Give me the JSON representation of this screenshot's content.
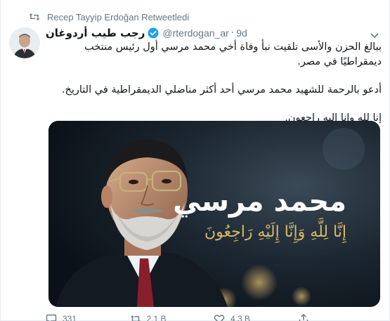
{
  "retweet": {
    "label": "Recep Tayyip Erdoğan Retweetledi",
    "icon": "retweet-icon"
  },
  "author": {
    "name": "رجب طيب أردوغان",
    "handle": "@rterdogan_ar",
    "separator": "·",
    "time": "9d",
    "verified_icon": "verified-badge-icon"
  },
  "tweet": {
    "paragraphs": [
      "ببالغ الحزن والأسى تلقيت نبأ وفاة أخي محمد مرسي أول رئيس منتخب ديمقراطيًا في مصر.",
      "أدعو بالرحمة للشهيد محمد مرسي أحد أكثر مناضلي الديمقراطية في التاريخ.",
      "إنا لله وإنا إليه راجعون."
    ]
  },
  "media": {
    "caption_name": "محمد مرسي",
    "caption_verse": "إِنَّا لِلَّهِ وَإِنَّا إِلَيْهِ رَاجِعُونَ"
  },
  "actions": {
    "reply_count": "331",
    "retweet_count": "2,1 B",
    "like_count": "4,3 B",
    "icons": [
      "reply-icon",
      "retweet-icon",
      "like-icon",
      "share-icon"
    ]
  },
  "colors": {
    "verified": "#1da1f2",
    "muted": "#657786",
    "text": "#14171a",
    "caption_gold": "#d9b86a"
  }
}
